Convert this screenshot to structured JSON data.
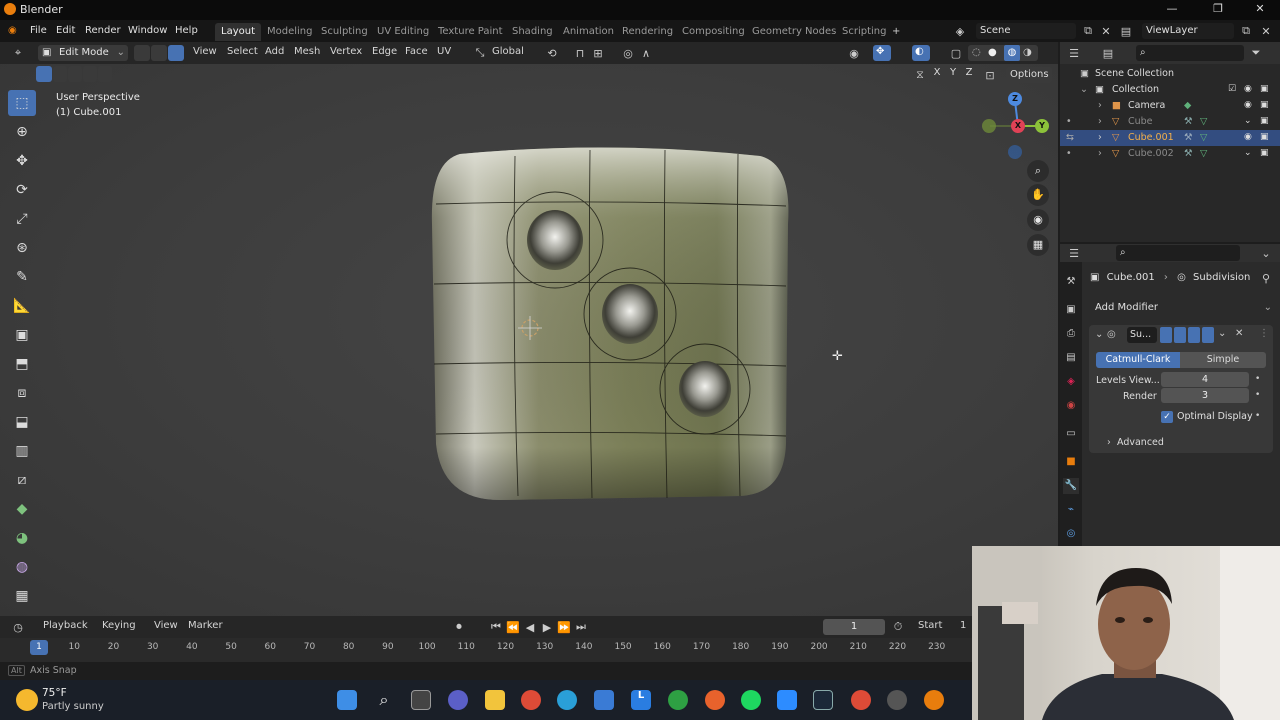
{
  "window": {
    "title": "Blender"
  },
  "menus": [
    "File",
    "Edit",
    "Render",
    "Window",
    "Help"
  ],
  "workspaces": [
    "Layout",
    "Modeling",
    "Sculpting",
    "UV Editing",
    "Texture Paint",
    "Shading",
    "Animation",
    "Rendering",
    "Compositing",
    "Geometry Nodes",
    "Scripting"
  ],
  "active_workspace": "Layout",
  "scene": {
    "name": "Scene",
    "view_layer": "ViewLayer"
  },
  "viewport_header": {
    "mode": "Edit Mode",
    "menus": [
      "View",
      "Select",
      "Add",
      "Mesh",
      "Vertex",
      "Edge",
      "Face",
      "UV"
    ],
    "transform_orientation": "Global",
    "options_label": "Options",
    "axis_labels": [
      "X",
      "Y",
      "Z"
    ]
  },
  "viewport": {
    "perspective": "User Perspective",
    "object_label": "(1) Cube.001",
    "gizmo": {
      "x": "X",
      "y": "Y",
      "z": "Z"
    }
  },
  "outliner": {
    "root": "Scene Collection",
    "items": [
      {
        "name": "Collection",
        "type": "collection"
      },
      {
        "name": "Camera",
        "type": "camera"
      },
      {
        "name": "Cube",
        "type": "mesh"
      },
      {
        "name": "Cube.001",
        "type": "mesh",
        "selected": true
      },
      {
        "name": "Cube.002",
        "type": "mesh"
      }
    ]
  },
  "properties": {
    "object": "Cube.001",
    "modifier_breadcrumb": "Subdivision",
    "add_modifier": "Add Modifier",
    "modifier": {
      "short_name": "Su...",
      "types": [
        "Catmull-Clark",
        "Simple"
      ],
      "active_type": "Catmull-Clark",
      "levels_viewport_label": "Levels View...",
      "levels_viewport": "4",
      "render_label": "Render",
      "render": "3",
      "optimal_display_label": "Optimal Display",
      "optimal_display": true,
      "advanced_label": "Advanced"
    }
  },
  "timeline": {
    "menus": [
      "Playback",
      "Keying",
      "View",
      "Marker"
    ],
    "current_frame": "1",
    "start_label": "Start",
    "start_value": "1",
    "ticks": [
      "1",
      "10",
      "20",
      "30",
      "40",
      "50",
      "60",
      "70",
      "80",
      "90",
      "100",
      "110",
      "120",
      "130",
      "140",
      "150",
      "160",
      "170",
      "180",
      "190",
      "200",
      "210",
      "220",
      "230"
    ]
  },
  "status": {
    "key": "Alt",
    "hint": "Axis Snap"
  },
  "weather": {
    "temp": "75°F",
    "desc": "Partly sunny"
  },
  "colors": {
    "accent": "#4772b3",
    "selected_row": "#334d80",
    "blender_orange": "#e87d0d"
  }
}
